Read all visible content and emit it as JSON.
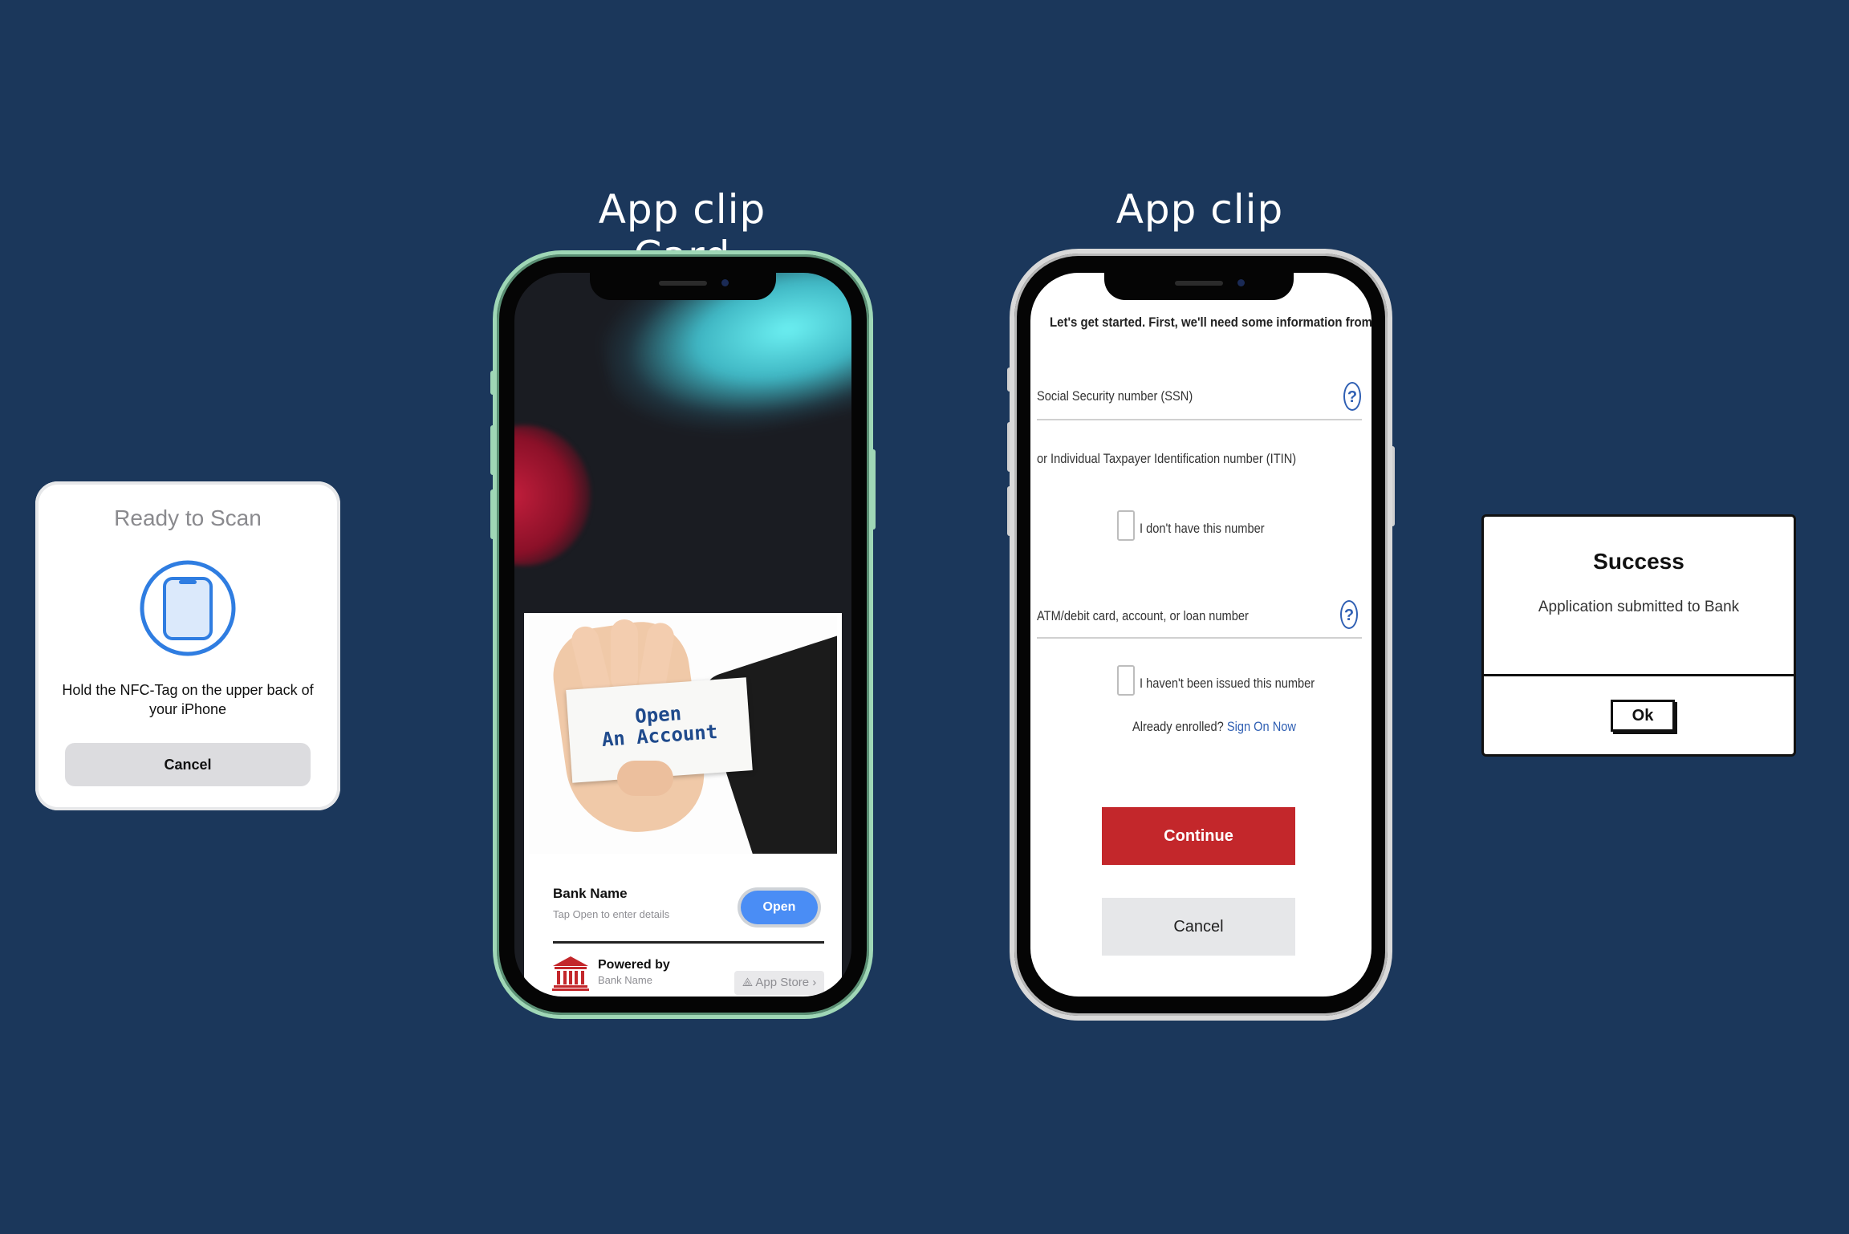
{
  "labels": {
    "card_title": "App clip Card",
    "clip_title": "App clip"
  },
  "nfc_sheet": {
    "title": "Ready to Scan",
    "icon": "phone-scan-icon",
    "message": "Hold the NFC-Tag on the upper back of your iPhone",
    "cancel_label": "Cancel"
  },
  "app_clip_card": {
    "card_text_line1": "Open",
    "card_text_line2": "An Account",
    "bank_name": "Bank Name",
    "subtitle": "Tap Open to enter details",
    "open_label": "Open",
    "powered_by": "Powered by",
    "powered_by_name": "Bank Name",
    "app_store_label": "App Store"
  },
  "app_clip_form": {
    "heading": "Let's get started. First, we'll need some information from you.",
    "ssn_label": "Social Security number (SSN)",
    "itin_label": "or Individual Taxpayer Identification number (ITIN)",
    "no_number_label": "I don't have this number",
    "account_label": "ATM/debit card, account, or loan number",
    "not_issued_label": "I haven't been issued this number",
    "already_enrolled": "Already enrolled?",
    "sign_on_link": "Sign On Now",
    "continue_label": "Continue",
    "cancel_label": "Cancel",
    "help_glyph": "?"
  },
  "success_dialog": {
    "title": "Success",
    "message": "Application submitted to Bank",
    "ok_label": "Ok"
  },
  "colors": {
    "background": "#1b375b",
    "primary_blue": "#4a8df5",
    "continue_red": "#c3272b",
    "link_blue": "#2f5fb3",
    "phone1_frame": "#9fd7b6"
  }
}
